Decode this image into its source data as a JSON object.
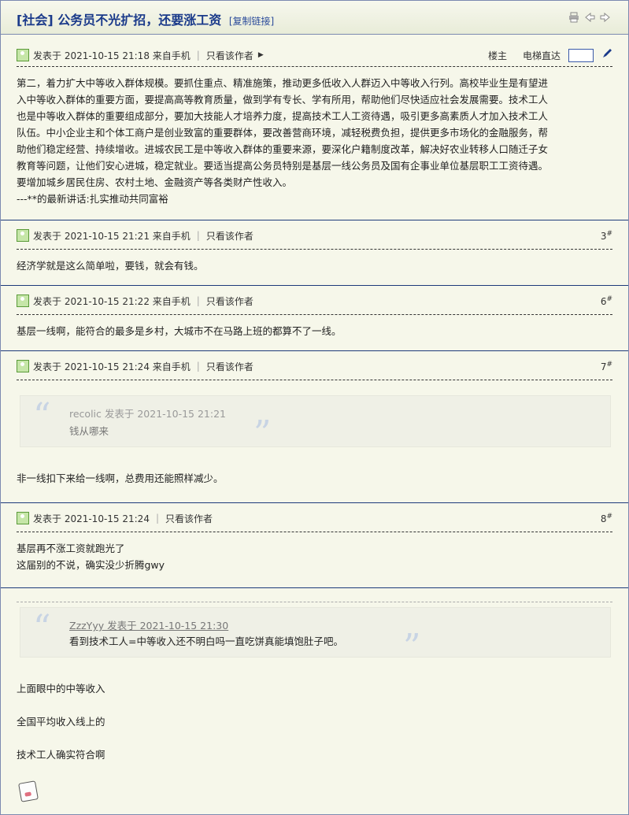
{
  "thread": {
    "tag": "[社会]",
    "title": "公务员不光扩招，还要涨工资",
    "copy_link": "[复制链接]"
  },
  "posts": [
    {
      "meta": "发表于 2021-10-15 21:18 来自手机",
      "only_author": "只看该作者",
      "louzhu": "楼主",
      "elevator": "电梯直达",
      "lines": [
        "第二，着力扩大中等收入群体规模。要抓住重点、精准施策，推动更多低收入人群迈入中等收入行列。高校毕业生是有望进",
        "入中等收入群体的重要方面，要提高高等教育质量，做到学有专长、学有所用，帮助他们尽快适应社会发展需要。技术工人",
        "也是中等收入群体的重要组成部分，要加大技能人才培养力度，提高技术工人工资待遇，吸引更多高素质人才加入技术工人",
        "队伍。中小企业主和个体工商户是创业致富的重要群体，要改善营商环境，减轻税费负担，提供更多市场化的金融服务，帮",
        "助他们稳定经营、持续增收。进城农民工是中等收入群体的重要来源，要深化户籍制度改革，解决好农业转移人口随迁子女",
        "教育等问题，让他们安心进城，稳定就业。要适当提高公务员特别是基层一线公务员及国有企事业单位基层职工工资待遇。",
        "要增加城乡居民住房、农村土地、金融资产等各类财产性收入。",
        "---**的最新讲话:扎实推动共同富裕"
      ]
    },
    {
      "meta": "发表于 2021-10-15 21:21 来自手机",
      "only_author": "只看该作者",
      "floor": "3",
      "text": "经济学就是这么简单啦，要钱，就会有钱。"
    },
    {
      "meta": "发表于 2021-10-15 21:22 来自手机",
      "only_author": "只看该作者",
      "floor": "6",
      "text": "基层一线啊，能符合的最多是乡村，大城市不在马路上班的都算不了一线。"
    },
    {
      "meta": "发表于 2021-10-15 21:24 来自手机",
      "only_author": "只看该作者",
      "floor": "7",
      "quote_author": "recolic 发表于 2021-10-15 21:21",
      "quote_text": "钱从哪来",
      "text": "非一线扣下来给一线啊，总费用还能照样减少。"
    },
    {
      "meta": "发表于 2021-10-15 21:24",
      "only_author": "只看该作者",
      "floor": "8",
      "lines": [
        "基层再不涨工资就跑光了",
        "这届别的不说，确实没少折腾gwy"
      ]
    },
    {
      "quote_author": "ZzzYyy 发表于 2021-10-15 21:30",
      "quote_text": "看到技术工人=中等收入还不明白吗一直吃饼真能填饱肚子吧。",
      "lines": [
        "上面眼中的中等收入",
        "全国平均收入线上的",
        "技术工人确实符合啊"
      ]
    }
  ],
  "icons": {
    "print": "print-icon",
    "prev": "arrow-left-icon",
    "next": "arrow-right-icon",
    "user": "user-icon",
    "pen": "pen-icon",
    "signature": "signature-icon"
  }
}
